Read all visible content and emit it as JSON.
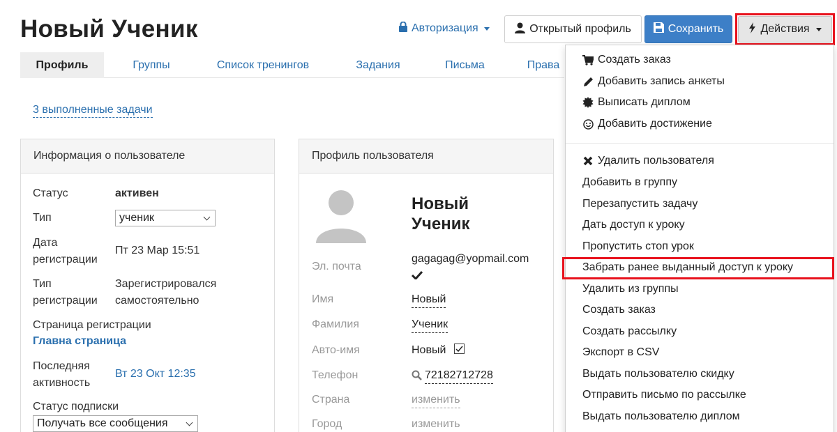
{
  "header": {
    "title": "Новый Ученик",
    "auth_label": "Авторизация",
    "open_profile_label": "Открытый профиль",
    "save_label": "Сохранить",
    "actions_label": "Действия"
  },
  "tabs": [
    {
      "label": "Профиль",
      "active": true
    },
    {
      "label": "Группы"
    },
    {
      "label": "Список тренингов"
    },
    {
      "label": "Задания"
    },
    {
      "label": "Письма"
    },
    {
      "label": "Права"
    }
  ],
  "tasks_link": "3 выполненные задачи",
  "user_info": {
    "title": "Информация о пользователе",
    "status_label": "Статус",
    "status_value": "активен",
    "type_label": "Тип",
    "type_value": "ученик",
    "reg_date_label_1": "Дата",
    "reg_date_label_2": "регистрации",
    "reg_date_value": "Пт 23 Мар 15:51",
    "reg_type_label_1": "Тип",
    "reg_type_label_2": "регистрации",
    "reg_type_value_1": "Зарегистрировался",
    "reg_type_value_2": "самостоятельно",
    "reg_page_label": "Страница регистрации",
    "reg_page_value": "Главна страница",
    "last_activity_label_1": "Последняя",
    "last_activity_label_2": "активность",
    "last_activity_value": "Вт 23 Окт 12:35",
    "subscription_label": "Статус подписки",
    "subscription_value": "Получать все сообщения"
  },
  "user_profile": {
    "title": "Профиль пользователя",
    "name_line1": "Новый",
    "name_line2": "Ученик",
    "email_label": "Эл. почта",
    "email_value": "gagagag@yopmail.com",
    "first_name_label": "Имя",
    "first_name_value": "Новый",
    "last_name_label": "Фамилия",
    "last_name_value": "Ученик",
    "auto_name_label": "Авто-имя",
    "auto_name_value": "Новый",
    "phone_label": "Телефон",
    "phone_value": "72182712728",
    "country_label": "Страна",
    "country_value": "изменить",
    "city_label": "Город",
    "city_value": "изменить"
  },
  "actions_menu": [
    {
      "label": "Создать заказ",
      "icon": "cart-icon"
    },
    {
      "label": "Добавить запись анкеты",
      "icon": "pencil-icon"
    },
    {
      "label": "Выписать диплом",
      "icon": "certificate-icon"
    },
    {
      "label": "Добавить достижение",
      "icon": "smile-icon"
    },
    {
      "label": "Удалить пользователя",
      "icon": "close-icon"
    },
    {
      "label": "Добавить в группу"
    },
    {
      "label": "Перезапустить задачу"
    },
    {
      "label": "Дать доступ к уроку"
    },
    {
      "label": "Пропустить стоп урок"
    },
    {
      "label": "Забрать ранее выданный доступ к уроку",
      "highlighted": true
    },
    {
      "label": "Удалить из группы"
    },
    {
      "label": "Создать заказ"
    },
    {
      "label": "Создать рассылку"
    },
    {
      "label": "Экспорт в CSV"
    },
    {
      "label": "Выдать пользователю скидку"
    },
    {
      "label": "Отправить письмо по рассылке"
    },
    {
      "label": "Выдать пользователю диплом"
    }
  ],
  "colors": {
    "accent": "#2a6fae",
    "save_button": "#3d7fc7",
    "highlight": "#e8121d"
  }
}
